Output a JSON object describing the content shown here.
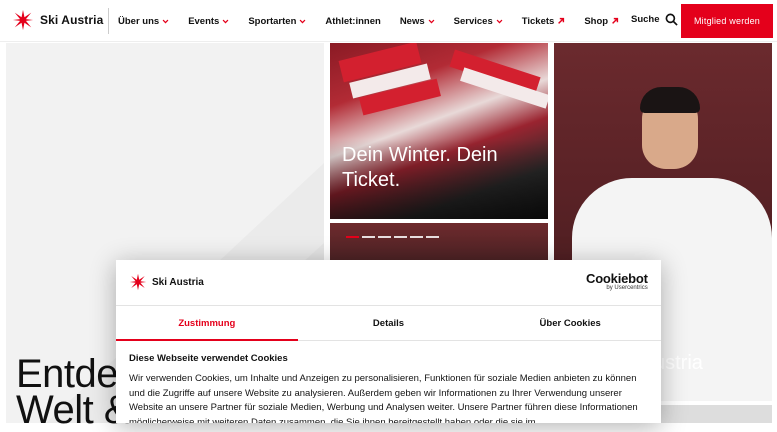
{
  "header": {
    "logo_text": "Ski Austria",
    "nav": [
      {
        "label": "Über uns",
        "icon": "chevron-down-icon"
      },
      {
        "label": "Events",
        "icon": "chevron-down-icon"
      },
      {
        "label": "Sportarten",
        "icon": "chevron-down-icon"
      },
      {
        "label": "Athlet:innen",
        "icon": ""
      },
      {
        "label": "News",
        "icon": "chevron-down-icon"
      },
      {
        "label": "Services",
        "icon": "chevron-down-icon"
      },
      {
        "label": "Tickets",
        "icon": "external-link-icon"
      },
      {
        "label": "Shop",
        "icon": "external-link-icon"
      }
    ],
    "search_label": "Suche",
    "cta_label": "Mitglied werden"
  },
  "hero": {
    "headline_line1": "Entde",
    "headline_line2": "Welt &"
  },
  "cards": {
    "ticket_title": "Dein Winter. Dein Ticket.",
    "athlete_text": "ustria",
    "slider_count": 6,
    "slider_active": 0
  },
  "cookie": {
    "logo_text": "Ski Austria",
    "brand": "Cookiebot",
    "brand_sub": "by Usercentrics",
    "tabs": [
      {
        "label": "Zustimmung",
        "active": true
      },
      {
        "label": "Details",
        "active": false
      },
      {
        "label": "Über Cookies",
        "active": false
      }
    ],
    "title": "Diese Webseite verwendet Cookies",
    "text": "Wir verwenden Cookies, um Inhalte und Anzeigen zu personalisieren, Funktionen für soziale Medien anbieten zu können und die Zugriffe auf unsere Website zu analysieren. Außerdem geben wir Informationen zu Ihrer Verwendung unserer Website an unsere Partner für soziale Medien, Werbung und Analysen weiter. Unsere Partner führen diese Informationen möglicherweise mit weiteren Daten zusammen, die Sie ihnen bereitgestellt haben oder die sie im"
  },
  "colors": {
    "accent": "#e4001b"
  }
}
